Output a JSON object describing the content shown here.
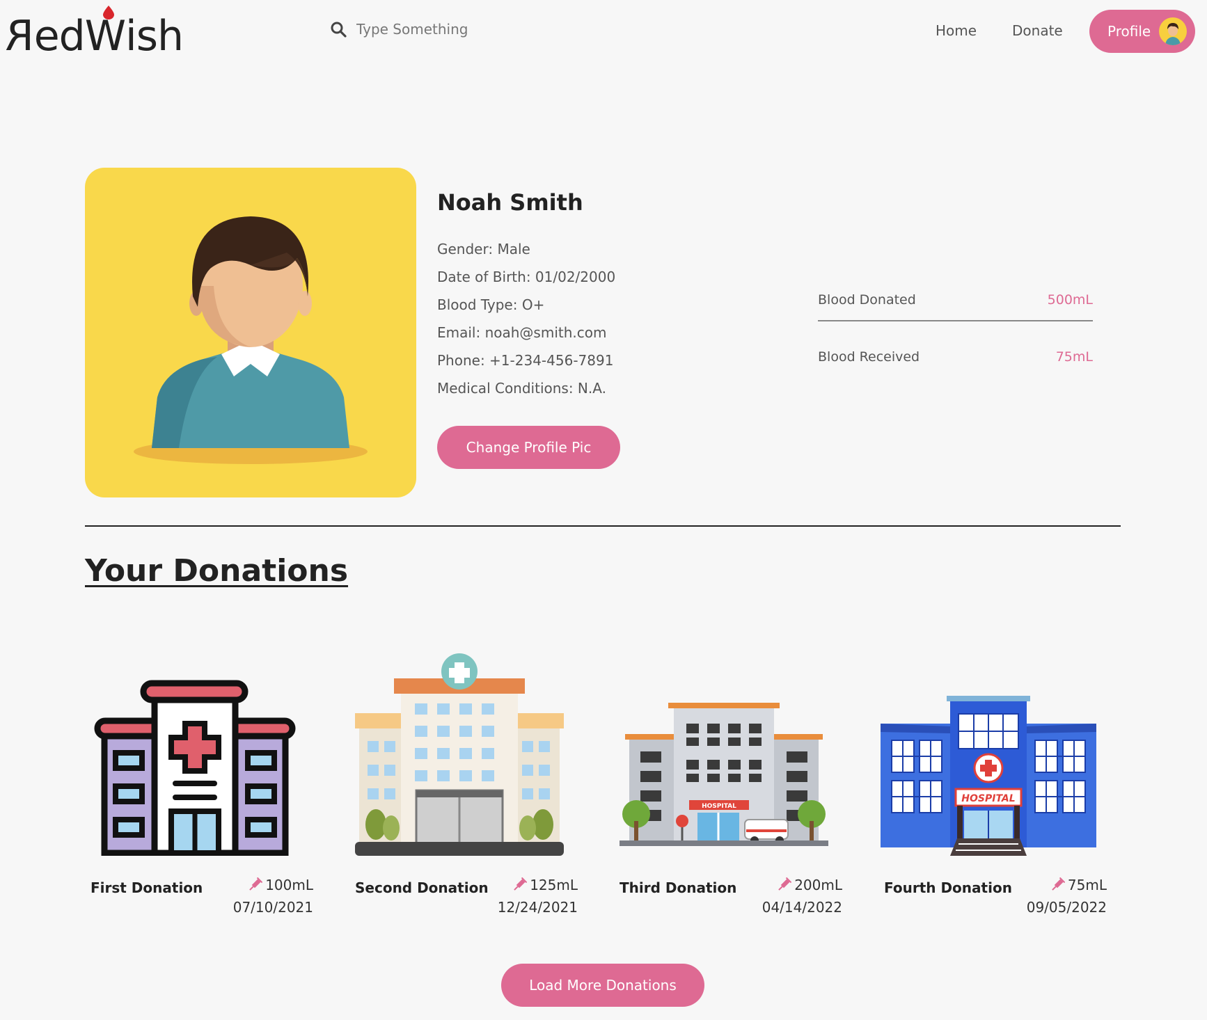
{
  "header": {
    "logo_part1": "R",
    "logo_part2": "ed",
    "logo_part3": "W",
    "logo_part4": "ish",
    "search_placeholder": "Type Something",
    "nav_home": "Home",
    "nav_donate": "Donate",
    "profile_label": "Profile"
  },
  "profile": {
    "name": "Noah Smith",
    "gender": "Gender: Male",
    "dob": "Date of Birth: 01/02/2000",
    "blood_type": "Blood Type: O+",
    "email": "Email: noah@smith.com",
    "phone": "Phone: +1-234-456-7891",
    "conditions": "Medical Conditions: N.A.",
    "change_pic_label": "Change Profile Pic"
  },
  "stats": {
    "donated_label": "Blood Donated",
    "donated_value": "500mL",
    "received_label": "Blood Received",
    "received_value": "75mL"
  },
  "donations_section": {
    "title": "Your Donations",
    "items": [
      {
        "title": "First Donation",
        "amount": "100mL",
        "date": "07/10/2021",
        "icon": "hospital-outline-icon"
      },
      {
        "title": "Second Donation",
        "amount": "125mL",
        "date": "12/24/2021",
        "icon": "hospital-flat-icon"
      },
      {
        "title": "Third Donation",
        "amount": "200mL",
        "date": "04/14/2022",
        "icon": "hospital-ambulance-icon"
      },
      {
        "title": "Fourth Donation",
        "amount": "75mL",
        "date": "09/05/2022",
        "icon": "hospital-blue-icon"
      }
    ],
    "load_more_label": "Load More Donations",
    "sign_text": "HOSPITAL"
  },
  "colors": {
    "accent": "#de6a93",
    "avatar_bg": "#f9d84b",
    "background": "#f7f7f7",
    "drop": "#d9262c"
  }
}
